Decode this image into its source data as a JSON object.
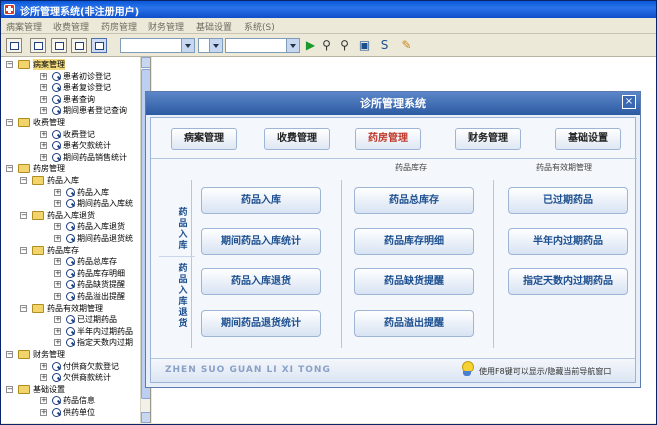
{
  "window": {
    "title": "诊所管理系统(非注册用户)"
  },
  "menu": [
    "病案管理",
    "收费管理",
    "药房管理",
    "财务管理",
    "基础设置",
    "系统(S)"
  ],
  "tree": [
    {
      "label": "病案管理",
      "type": "folder",
      "level": 0,
      "selected": true
    },
    {
      "label": "患者初诊登记",
      "type": "leaf",
      "level": 1
    },
    {
      "label": "患者复诊登记",
      "type": "leaf",
      "level": 1
    },
    {
      "label": "患者查询",
      "type": "leaf",
      "level": 1
    },
    {
      "label": "期间患者登记查询",
      "type": "leaf",
      "level": 1
    },
    {
      "label": "收费管理",
      "type": "folder",
      "level": 0
    },
    {
      "label": "收费登记",
      "type": "leaf",
      "level": 1
    },
    {
      "label": "患者欠款统计",
      "type": "leaf",
      "level": 1
    },
    {
      "label": "期间药品销售统计",
      "type": "leaf",
      "level": 1
    },
    {
      "label": "药房管理",
      "type": "folder",
      "level": 0
    },
    {
      "label": "药品入库",
      "type": "folder",
      "level": 1
    },
    {
      "label": "药品入库",
      "type": "leaf",
      "level": 2
    },
    {
      "label": "期间药品入库统",
      "type": "leaf",
      "level": 2
    },
    {
      "label": "药品入库退货",
      "type": "folder",
      "level": 1
    },
    {
      "label": "药品入库退货",
      "type": "leaf",
      "level": 2
    },
    {
      "label": "期间药品退货统",
      "type": "leaf",
      "level": 2
    },
    {
      "label": "药品库存",
      "type": "folder",
      "level": 1
    },
    {
      "label": "药品总库存",
      "type": "leaf",
      "level": 2
    },
    {
      "label": "药品库存明细",
      "type": "leaf",
      "level": 2
    },
    {
      "label": "药品缺货提醒",
      "type": "leaf",
      "level": 2
    },
    {
      "label": "药品溢出提醒",
      "type": "leaf",
      "level": 2
    },
    {
      "label": "药品有效期管理",
      "type": "folder",
      "level": 1
    },
    {
      "label": "已过期药品",
      "type": "leaf",
      "level": 2
    },
    {
      "label": "半年内过期药品",
      "type": "leaf",
      "level": 2
    },
    {
      "label": "指定天数内过期",
      "type": "leaf",
      "level": 2
    },
    {
      "label": "财务管理",
      "type": "folder",
      "level": 0
    },
    {
      "label": "付供商欠款登记",
      "type": "leaf",
      "level": 1
    },
    {
      "label": "欠供商款统计",
      "type": "leaf",
      "level": 1
    },
    {
      "label": "基础设置",
      "type": "folder",
      "level": 0
    },
    {
      "label": "药品信息",
      "type": "leaf",
      "level": 1
    },
    {
      "label": "供药单位",
      "type": "leaf",
      "level": 1
    }
  ],
  "dialog": {
    "title": "诊所管理系统",
    "close": "×",
    "tabs": [
      "病案管理",
      "收费管理",
      "药房管理",
      "财务管理",
      "基础设置"
    ],
    "active_tab": 2,
    "sections": {
      "stock_title": "药品库存",
      "expiry_title": "药品有效期管理",
      "side_in": "药品入库",
      "side_return": "药品入库退货"
    },
    "buttons": {
      "in": "药品入库",
      "in_stats": "期间药品入库统计",
      "ret": "药品入库退货",
      "ret_stats": "期间药品退货统计",
      "total": "药品总库存",
      "detail": "药品库存明细",
      "short": "药品缺货提醒",
      "over": "药品溢出提醒",
      "expired": "已过期药品",
      "half": "半年内过期药品",
      "days": "指定天数内过期药品"
    },
    "brand": "ZHEN SUO GUAN LI XI TONG",
    "hint": "使用F8键可以显示/隐藏当前导航窗口"
  }
}
